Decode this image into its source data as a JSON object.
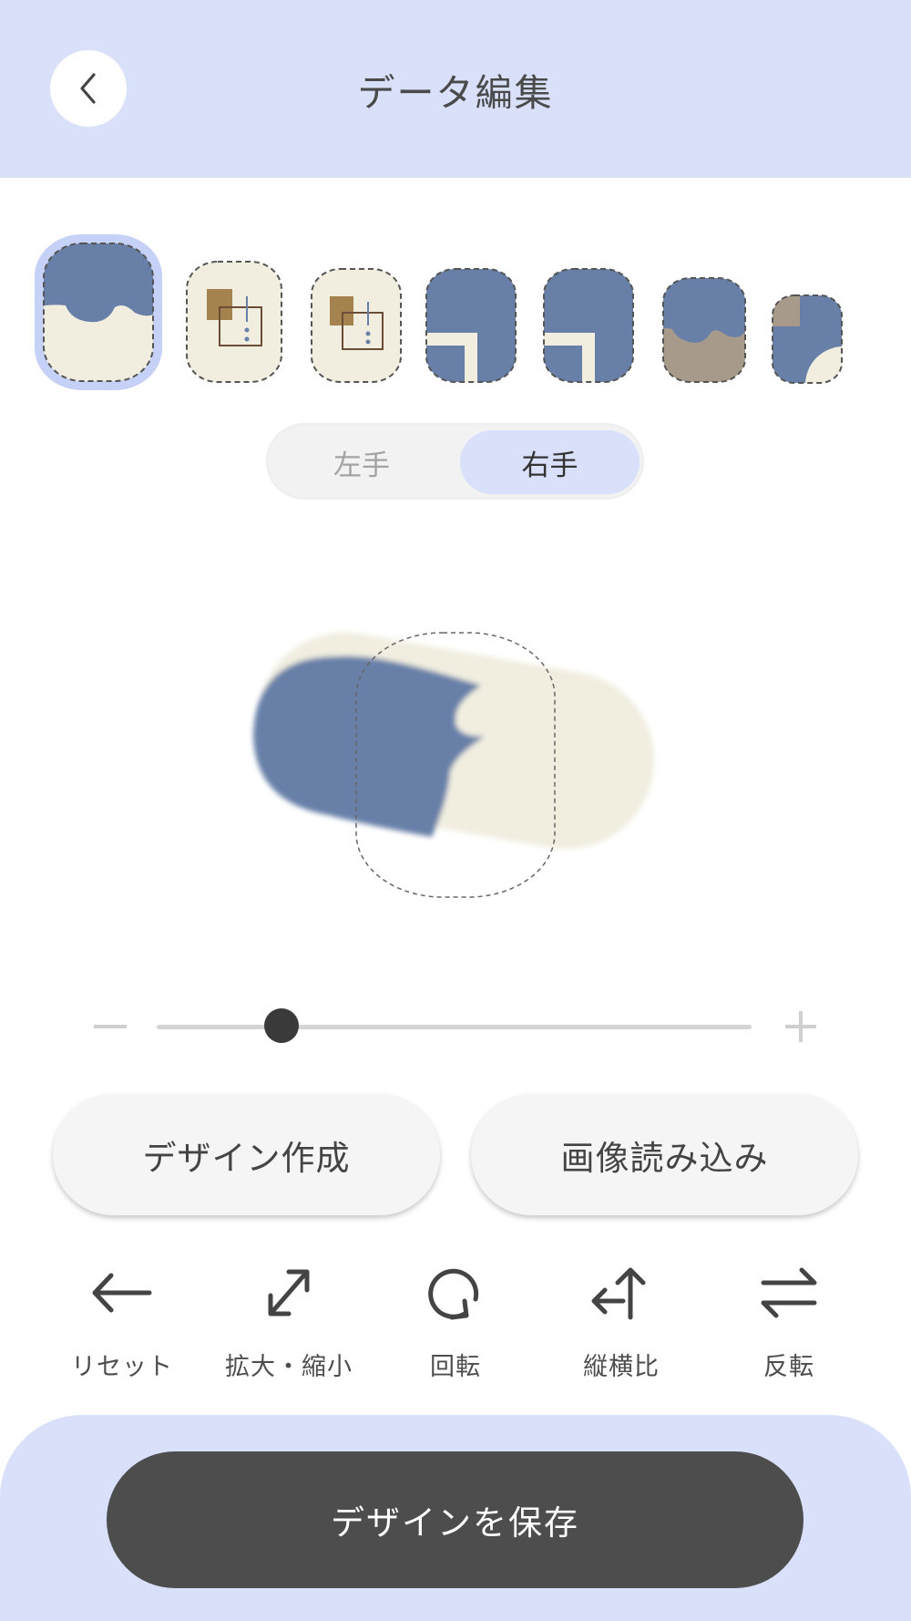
{
  "header": {
    "title": "データ編集",
    "back_icon": "chevron-left-icon"
  },
  "nail_thumbnails": [
    {
      "design": "blue-scallop-on-cream",
      "selected": true
    },
    {
      "design": "cream-with-gold-squares",
      "selected": false
    },
    {
      "design": "cream-with-gold-squares",
      "selected": false
    },
    {
      "design": "blue-with-cream-corner",
      "selected": false
    },
    {
      "design": "blue-with-cream-corner",
      "selected": false
    },
    {
      "design": "blue-scallop-on-taupe",
      "selected": false
    },
    {
      "design": "blue-with-taupe-and-cream-corners",
      "selected": false
    }
  ],
  "hand_toggle": {
    "left_label": "左手",
    "right_label": "右手",
    "selected": "右手"
  },
  "zoom_slider": {
    "minus_icon": "minus-icon",
    "plus_icon": "plus-icon",
    "value_fraction": 0.21
  },
  "actions": {
    "design_create": "デザイン作成",
    "image_load": "画像読み込み"
  },
  "tools": [
    {
      "label": "リセット",
      "icon": "arrow-left-icon"
    },
    {
      "label": "拡大・縮小",
      "icon": "expand-arrows-icon"
    },
    {
      "label": "回転",
      "icon": "rotate-icon"
    },
    {
      "label": "縦横比",
      "icon": "aspect-ratio-icon"
    },
    {
      "label": "反転",
      "icon": "flip-arrows-icon"
    }
  ],
  "footer": {
    "save_label": "デザインを保存"
  },
  "colors": {
    "accent_light": "#d8e0fa",
    "nail_blue": "#6880a8",
    "nail_cream": "#f1eee0",
    "nail_gold": "#a5834f",
    "nail_taupe": "#a89a8a",
    "dark_button": "#4d4d4d"
  }
}
